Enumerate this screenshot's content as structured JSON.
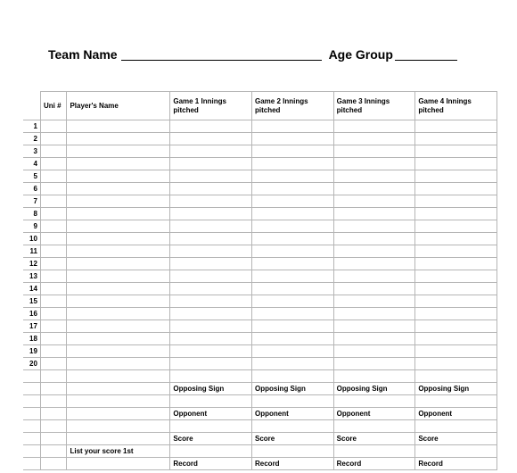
{
  "header": {
    "team_name_label": "Team Name",
    "age_group_label": "Age Group"
  },
  "columns": {
    "uni_header": "Uni #",
    "player_header": "Player's Name",
    "game1": "Game 1 Innings pitched",
    "game2": "Game 2 Innings pitched",
    "game3": "Game 3 Innings pitched",
    "game4": "Game 4 Innings pitched"
  },
  "rows": [
    {
      "n": "1",
      "uni": "",
      "name": "",
      "g1": "",
      "g2": "",
      "g3": "",
      "g4": ""
    },
    {
      "n": "2",
      "uni": "",
      "name": "",
      "g1": "",
      "g2": "",
      "g3": "",
      "g4": ""
    },
    {
      "n": "3",
      "uni": "",
      "name": "",
      "g1": "",
      "g2": "",
      "g3": "",
      "g4": ""
    },
    {
      "n": "4",
      "uni": "",
      "name": "",
      "g1": "",
      "g2": "",
      "g3": "",
      "g4": ""
    },
    {
      "n": "5",
      "uni": "",
      "name": "",
      "g1": "",
      "g2": "",
      "g3": "",
      "g4": ""
    },
    {
      "n": "6",
      "uni": "",
      "name": "",
      "g1": "",
      "g2": "",
      "g3": "",
      "g4": ""
    },
    {
      "n": "7",
      "uni": "",
      "name": "",
      "g1": "",
      "g2": "",
      "g3": "",
      "g4": ""
    },
    {
      "n": "8",
      "uni": "",
      "name": "",
      "g1": "",
      "g2": "",
      "g3": "",
      "g4": ""
    },
    {
      "n": "9",
      "uni": "",
      "name": "",
      "g1": "",
      "g2": "",
      "g3": "",
      "g4": ""
    },
    {
      "n": "10",
      "uni": "",
      "name": "",
      "g1": "",
      "g2": "",
      "g3": "",
      "g4": ""
    },
    {
      "n": "11",
      "uni": "",
      "name": "",
      "g1": "",
      "g2": "",
      "g3": "",
      "g4": ""
    },
    {
      "n": "12",
      "uni": "",
      "name": "",
      "g1": "",
      "g2": "",
      "g3": "",
      "g4": ""
    },
    {
      "n": "13",
      "uni": "",
      "name": "",
      "g1": "",
      "g2": "",
      "g3": "",
      "g4": ""
    },
    {
      "n": "14",
      "uni": "",
      "name": "",
      "g1": "",
      "g2": "",
      "g3": "",
      "g4": ""
    },
    {
      "n": "15",
      "uni": "",
      "name": "",
      "g1": "",
      "g2": "",
      "g3": "",
      "g4": ""
    },
    {
      "n": "16",
      "uni": "",
      "name": "",
      "g1": "",
      "g2": "",
      "g3": "",
      "g4": ""
    },
    {
      "n": "17",
      "uni": "",
      "name": "",
      "g1": "",
      "g2": "",
      "g3": "",
      "g4": ""
    },
    {
      "n": "18",
      "uni": "",
      "name": "",
      "g1": "",
      "g2": "",
      "g3": "",
      "g4": ""
    },
    {
      "n": "19",
      "uni": "",
      "name": "",
      "g1": "",
      "g2": "",
      "g3": "",
      "g4": ""
    },
    {
      "n": "20",
      "uni": "",
      "name": "",
      "g1": "",
      "g2": "",
      "g3": "",
      "g4": ""
    }
  ],
  "footer": {
    "opposing_sign": "Opposing Sign",
    "opponent": "Opponent",
    "score": "Score",
    "record": "Record",
    "list_score_label": "List your score 1st"
  }
}
